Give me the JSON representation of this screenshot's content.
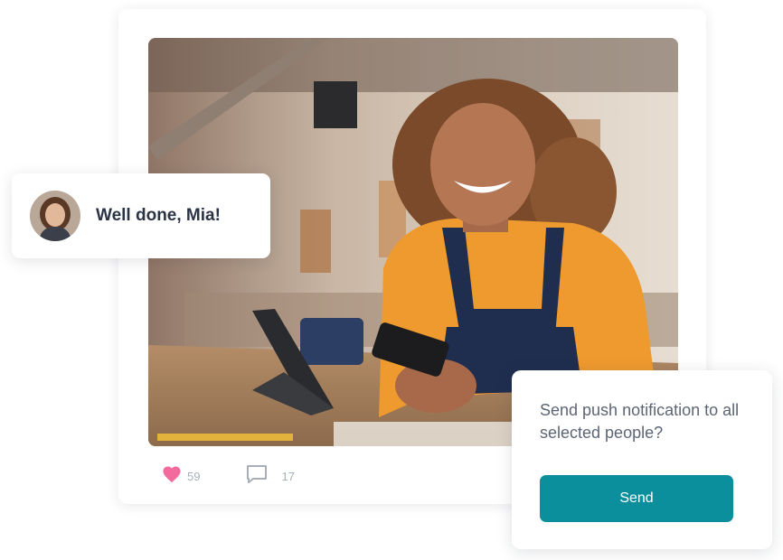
{
  "message": {
    "text": "Well done, Mia!"
  },
  "post": {
    "likes": "59",
    "comments": "17"
  },
  "notification": {
    "prompt": "Send push notification to all selected people?",
    "send_label": "Send"
  },
  "colors": {
    "accent": "#0b8f9c",
    "heart": "#f26b9c",
    "text_dark": "#2b3445",
    "text_muted": "#5d6674",
    "count_gray": "#a9afb8"
  },
  "icons": {
    "like": "heart-icon",
    "comment": "comment-bubble-icon"
  }
}
